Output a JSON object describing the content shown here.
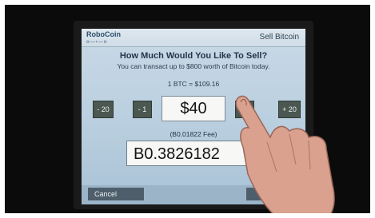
{
  "kiosk": {
    "logo": "RoboCoin",
    "title": "Sell Bitcoin",
    "question": "How Much Would You Like To Sell?",
    "subline": "You can transact up to $800 worth of Bitcoin today.",
    "rate": "1 BTC = $109.16",
    "buttons": {
      "minus20": "- 20",
      "minus1": "- 1",
      "plus1": "+ 1",
      "plus20": "+ 20"
    },
    "amount": "$40",
    "fee": "(B0.01822 Fee)",
    "btc_amount": "B0.3826182",
    "cancel": "Cancel"
  },
  "colors": {
    "screen": "#c0d5e5",
    "button": "#4b5751",
    "bezel": "#0b0b0b"
  }
}
